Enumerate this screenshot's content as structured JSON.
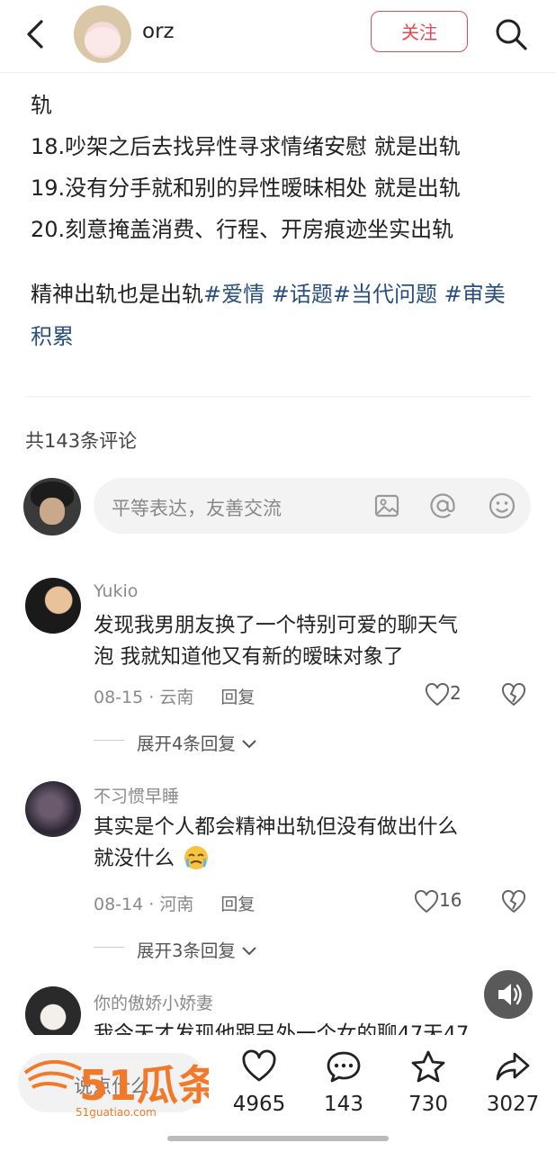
{
  "header": {
    "author_name": "orz",
    "follow_label": "关注"
  },
  "post": {
    "lines": [
      "轨",
      "18.吵架之后去找异性寻求情绪安慰 就是出轨",
      "19.没有分手就和别的异性暧昧相处 就是出轨",
      "20.刻意掩盖消费、行程、开房痕迹坐实出轨"
    ],
    "summary": "精神出轨也是出轨",
    "tags": [
      "#爱情",
      "#话题",
      "#当代问题",
      "#审美积累"
    ]
  },
  "comments_section": {
    "count_label": "共143条评论",
    "input_placeholder": "平等表达，友善交流"
  },
  "comments": [
    {
      "name": "Yukio",
      "text_line1": "发现我男朋友换了一个特别可爱的聊天气",
      "text_line2": "泡 我就知道他又有新的暧昧对象了",
      "date": "08-15",
      "location": "云南",
      "reply_label": "回复",
      "likes": "2",
      "expand_label": "展开4条回复"
    },
    {
      "name": "不习惯早睡",
      "text_line1": "其实是个人都会精神出轨但没有做出什么",
      "text_line2": "就没什么",
      "date": "08-14",
      "location": "河南",
      "reply_label": "回复",
      "likes": "16",
      "expand_label": "展开3条回复"
    },
    {
      "name": "你的傲娇小娇妻",
      "text_line1": "我今天才发现他跟另外一个女的聊47天47"
    }
  ],
  "bottom_bar": {
    "say_label": "说点什么",
    "watermark_main": "51瓜条",
    "watermark_sub": "51guatiao.com",
    "likes": "4965",
    "comments": "143",
    "favorites": "730",
    "shares": "3027"
  },
  "colors": {
    "accent": "#e24a53",
    "tag": "#2a4f7a",
    "watermark": "#f07a2a"
  }
}
